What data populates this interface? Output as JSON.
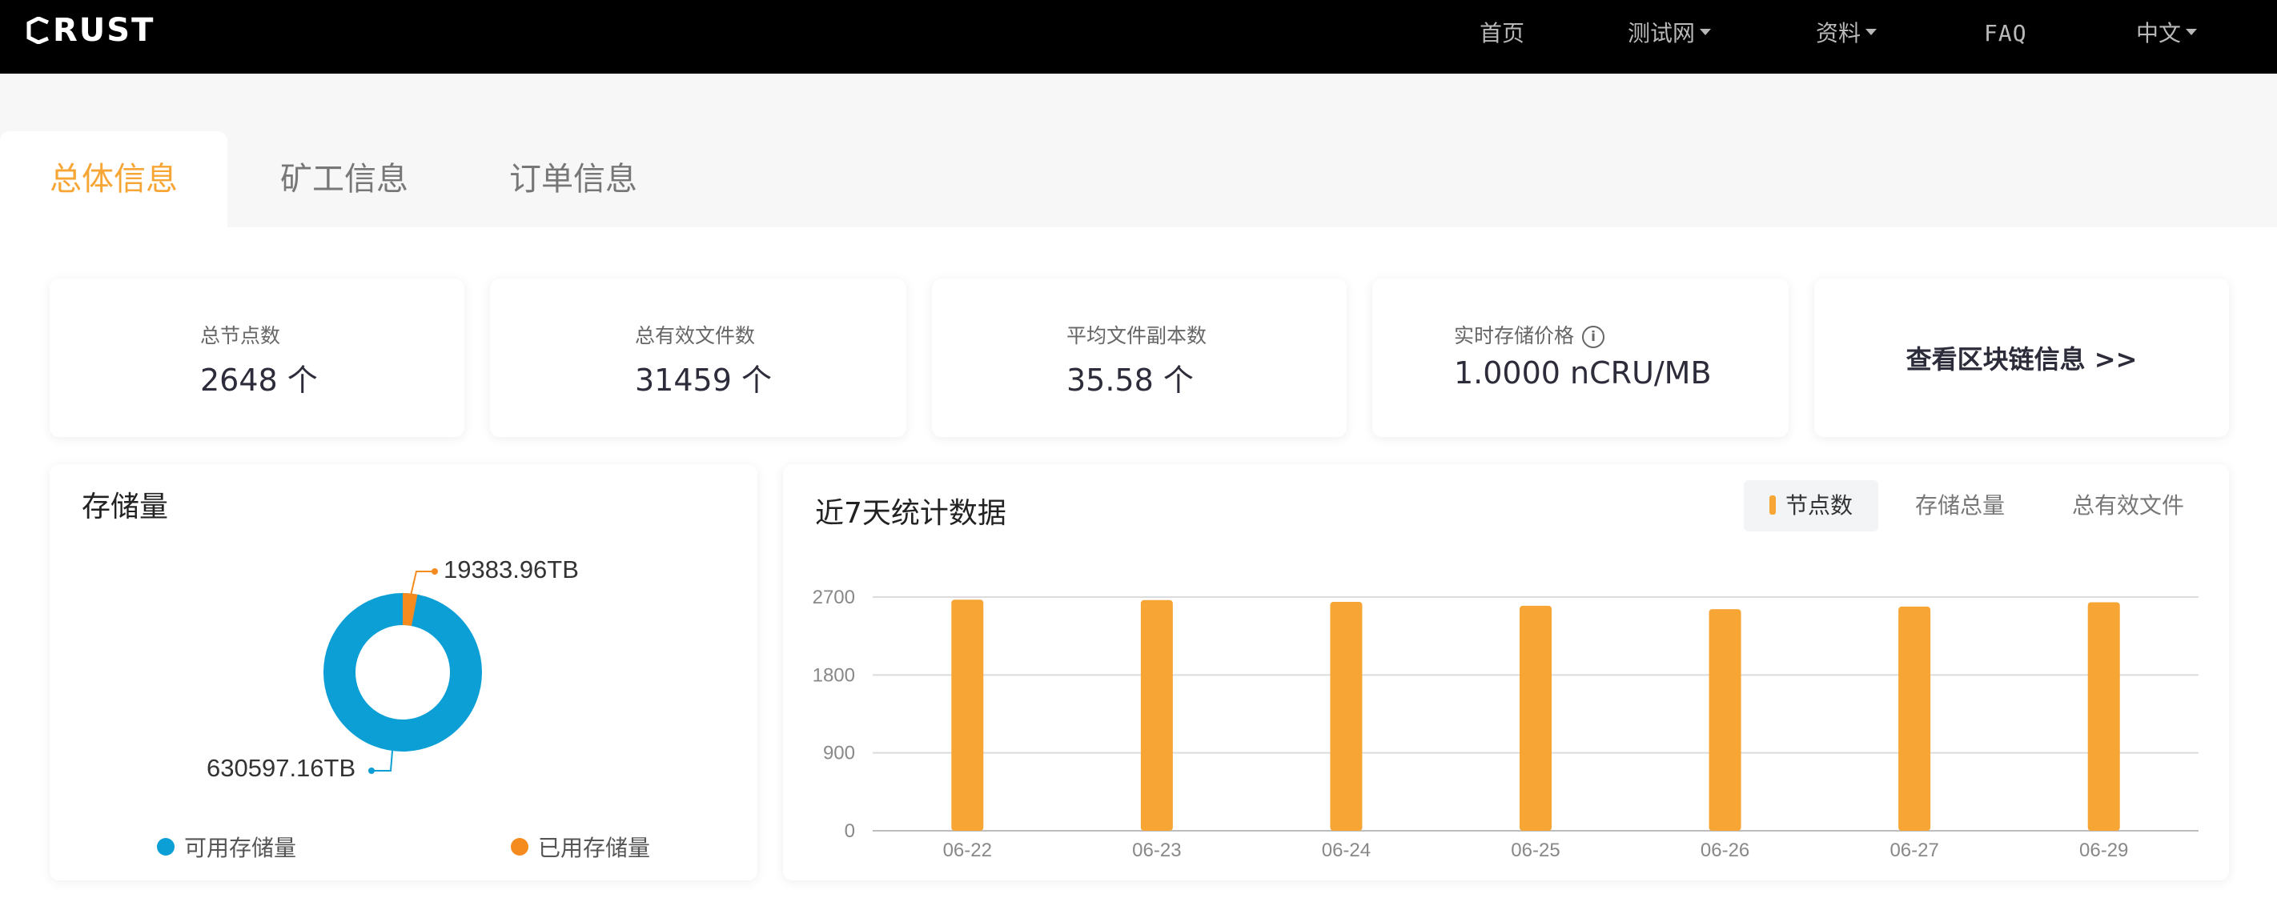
{
  "nav": {
    "logo_text": "RUST",
    "items": [
      {
        "label": "首页",
        "dropdown": false
      },
      {
        "label": "测试网",
        "dropdown": true
      },
      {
        "label": "资料",
        "dropdown": true
      },
      {
        "label": "FAQ",
        "dropdown": false
      },
      {
        "label": "中文",
        "dropdown": true
      }
    ]
  },
  "tabs": [
    {
      "label": "总体信息",
      "active": true
    },
    {
      "label": "矿工信息",
      "active": false
    },
    {
      "label": "订单信息",
      "active": false
    }
  ],
  "stats": [
    {
      "label": "总节点数",
      "value": "2648 个"
    },
    {
      "label": "总有效文件数",
      "value": "31459 个"
    },
    {
      "label": "平均文件副本数",
      "value": "35.58 个"
    },
    {
      "label": "实时存储价格",
      "value": "1.0000 nCRU/MB",
      "info_icon": "info-icon"
    }
  ],
  "chain_link": "查看区块链信息 >>",
  "storage": {
    "title": "存储量",
    "used_label": "19383.96TB",
    "available_label": "630597.16TB",
    "legend": [
      {
        "label": "可用存储量",
        "color": "#0b9fd6"
      },
      {
        "label": "已用存储量",
        "color": "#f58a1f"
      }
    ]
  },
  "stats_chart": {
    "title": "近7天统计数据",
    "tabs": [
      "节点数",
      "存储总量",
      "总有效文件"
    ],
    "active_tab": 0
  },
  "chart_data": [
    {
      "type": "pie",
      "title": "存储量",
      "labels": [
        "可用存储量",
        "已用存储量"
      ],
      "values": [
        630597.16,
        19383.96
      ],
      "units": "TB",
      "colors": [
        "#0b9fd6",
        "#f58a1f"
      ],
      "donut": true,
      "legend_position": "bottom"
    },
    {
      "type": "bar",
      "title": "近7天统计数据",
      "categories": [
        "06-22",
        "06-23",
        "06-24",
        "06-25",
        "06-26",
        "06-27",
        "06-29"
      ],
      "values": [
        2670,
        2665,
        2645,
        2600,
        2560,
        2590,
        2640
      ],
      "yticks": [
        0,
        900,
        1800,
        2700
      ],
      "ylim": [
        0,
        2700
      ],
      "grid": true,
      "color": "#f7a534"
    }
  ]
}
